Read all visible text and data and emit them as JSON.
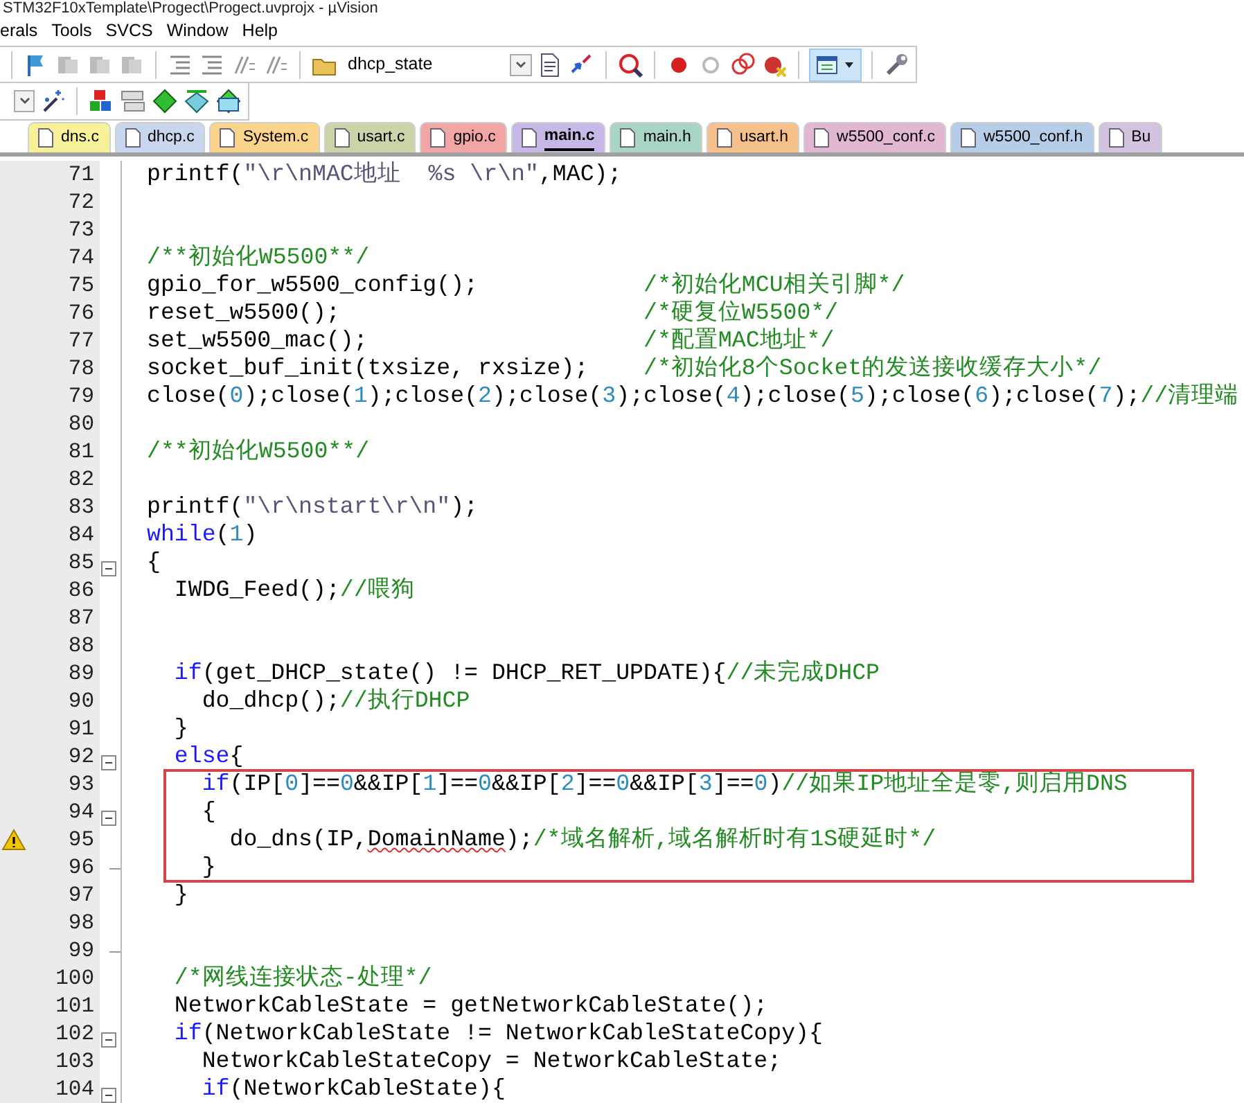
{
  "window": {
    "title": "STM32F10xTemplate\\Progect\\Progect.uvprojx - µVision"
  },
  "menu": [
    "erals",
    "Tools",
    "SVCS",
    "Window",
    "Help"
  ],
  "toolbar": {
    "target_combo": "dhcp_state",
    "window_button_pressed": true
  },
  "tabs": [
    {
      "label": "dns.c",
      "color": "#f7f29a",
      "selected": false
    },
    {
      "label": "dhcp.c",
      "color": "#c9d7ee",
      "selected": false
    },
    {
      "label": "System.c",
      "color": "#f9d48a",
      "selected": false
    },
    {
      "label": "usart.c",
      "color": "#c9d5a8",
      "selected": false
    },
    {
      "label": "gpio.c",
      "color": "#f2a5a5",
      "selected": false
    },
    {
      "label": "main.c",
      "color": "#c8b8e8",
      "selected": true
    },
    {
      "label": "main.h",
      "color": "#a9d5c5",
      "selected": false
    },
    {
      "label": "usart.h",
      "color": "#f6c08a",
      "selected": false
    },
    {
      "label": "w5500_conf.c",
      "color": "#e2b8d0",
      "selected": false
    },
    {
      "label": "w5500_conf.h",
      "color": "#b5cde6",
      "selected": false
    },
    {
      "label": "Bu",
      "color": "#d2c3e0",
      "selected": false
    }
  ],
  "editor": {
    "lines": [
      {
        "number": "71",
        "segments": [
          {
            "kind": "code",
            "text": "printf("
          },
          {
            "kind": "string",
            "text": "\"\\r\\nMAC地址  %s \\r\\n\""
          },
          {
            "kind": "code",
            "text": ",MAC);"
          }
        ]
      },
      {
        "number": "72"
      },
      {
        "number": "73"
      },
      {
        "number": "74",
        "segments": [
          {
            "kind": "comment",
            "text": "/**初始化W5500**/"
          }
        ]
      },
      {
        "number": "75",
        "segments": [
          {
            "kind": "code",
            "text": "gpio_for_w5500_config();            "
          },
          {
            "kind": "comment",
            "text": "/*初始化MCU相关引脚*/"
          }
        ]
      },
      {
        "number": "76",
        "segments": [
          {
            "kind": "code",
            "text": "reset_w5500();                      "
          },
          {
            "kind": "comment",
            "text": "/*硬复位W5500*/"
          }
        ]
      },
      {
        "number": "77",
        "segments": [
          {
            "kind": "code",
            "text": "set_w5500_mac();                    "
          },
          {
            "kind": "comment",
            "text": "/*配置MAC地址*/"
          }
        ]
      },
      {
        "number": "78",
        "segments": [
          {
            "kind": "code",
            "text": "socket_buf_init(txsize, rxsize);    "
          },
          {
            "kind": "comment",
            "text": "/*初始化8个Socket的发送接收缓存大小*/"
          }
        ]
      },
      {
        "number": "79",
        "segments": [
          {
            "kind": "code",
            "text": "close("
          },
          {
            "kind": "number",
            "text": "0"
          },
          {
            "kind": "code",
            "text": ");close("
          },
          {
            "kind": "number",
            "text": "1"
          },
          {
            "kind": "code",
            "text": ");close("
          },
          {
            "kind": "number",
            "text": "2"
          },
          {
            "kind": "code",
            "text": ");close("
          },
          {
            "kind": "number",
            "text": "3"
          },
          {
            "kind": "code",
            "text": ");close("
          },
          {
            "kind": "number",
            "text": "4"
          },
          {
            "kind": "code",
            "text": ");close("
          },
          {
            "kind": "number",
            "text": "5"
          },
          {
            "kind": "code",
            "text": ");close("
          },
          {
            "kind": "number",
            "text": "6"
          },
          {
            "kind": "code",
            "text": ");close("
          },
          {
            "kind": "number",
            "text": "7"
          },
          {
            "kind": "code",
            "text": ");"
          },
          {
            "kind": "comment",
            "text": "//清理端"
          }
        ]
      },
      {
        "number": "80"
      },
      {
        "number": "81",
        "segments": [
          {
            "kind": "comment",
            "text": "/**初始化W5500**/"
          }
        ]
      },
      {
        "number": "82"
      },
      {
        "number": "83",
        "segments": [
          {
            "kind": "code",
            "text": "printf("
          },
          {
            "kind": "string",
            "text": "\"\\r\\nstart\\r\\n\""
          },
          {
            "kind": "code",
            "text": ");"
          }
        ]
      },
      {
        "number": "84",
        "segments": [
          {
            "kind": "keyword",
            "text": "while"
          },
          {
            "kind": "code",
            "text": "("
          },
          {
            "kind": "number",
            "text": "1"
          },
          {
            "kind": "code",
            "text": ")"
          }
        ]
      },
      {
        "number": "85",
        "fold_expanded": true,
        "segments": [
          {
            "kind": "code",
            "text": "{"
          }
        ]
      },
      {
        "number": "86",
        "segments": [
          {
            "kind": "code",
            "text": "  IWDG_Feed();"
          },
          {
            "kind": "comment",
            "text": "//喂狗"
          }
        ]
      },
      {
        "number": "87"
      },
      {
        "number": "88"
      },
      {
        "number": "89",
        "segments": [
          {
            "kind": "keyword",
            "text": "  if"
          },
          {
            "kind": "code",
            "text": "(get_DHCP_state() != DHCP_RET_UPDATE){"
          },
          {
            "kind": "comment",
            "text": "//未完成DHCP"
          }
        ]
      },
      {
        "number": "90",
        "segments": [
          {
            "kind": "code",
            "text": "    do_dhcp();"
          },
          {
            "kind": "comment",
            "text": "//执行DHCP"
          }
        ]
      },
      {
        "number": "91",
        "segments": [
          {
            "kind": "code",
            "text": "  }"
          }
        ]
      },
      {
        "number": "92",
        "fold_expanded": true,
        "segments": [
          {
            "kind": "keyword",
            "text": "  else"
          },
          {
            "kind": "code",
            "text": "{"
          }
        ]
      },
      {
        "number": "93",
        "boxed": true,
        "segments": [
          {
            "kind": "keyword",
            "text": "    if"
          },
          {
            "kind": "code",
            "text": "(IP["
          },
          {
            "kind": "number",
            "text": "0"
          },
          {
            "kind": "code",
            "text": "]=="
          },
          {
            "kind": "number",
            "text": "0"
          },
          {
            "kind": "code",
            "text": "&&IP["
          },
          {
            "kind": "number",
            "text": "1"
          },
          {
            "kind": "code",
            "text": "]=="
          },
          {
            "kind": "number",
            "text": "0"
          },
          {
            "kind": "code",
            "text": "&&IP["
          },
          {
            "kind": "number",
            "text": "2"
          },
          {
            "kind": "code",
            "text": "]=="
          },
          {
            "kind": "number",
            "text": "0"
          },
          {
            "kind": "code",
            "text": "&&IP["
          },
          {
            "kind": "number",
            "text": "3"
          },
          {
            "kind": "code",
            "text": "]=="
          },
          {
            "kind": "number",
            "text": "0"
          },
          {
            "kind": "code",
            "text": ")"
          },
          {
            "kind": "comment",
            "text": "//如果IP地址全是零,则启用DNS"
          }
        ]
      },
      {
        "number": "94",
        "boxed": true,
        "fold_expanded": true,
        "segments": [
          {
            "kind": "code",
            "text": "    {"
          }
        ]
      },
      {
        "number": "95",
        "boxed": true,
        "warning": true,
        "segments": [
          {
            "kind": "code",
            "text": "      do_dns(IP,"
          },
          {
            "kind": "error",
            "text": "DomainName"
          },
          {
            "kind": "code",
            "text": ");"
          },
          {
            "kind": "comment",
            "text": "/*域名解析,域名解析时有1S硬延时*/"
          }
        ]
      },
      {
        "number": "96",
        "boxed": true,
        "fold_end": true,
        "segments": [
          {
            "kind": "code",
            "text": "    }"
          }
        ]
      },
      {
        "number": "97",
        "segments": [
          {
            "kind": "code",
            "text": "  }"
          }
        ]
      },
      {
        "number": "98"
      },
      {
        "number": "99",
        "fold_end": true
      },
      {
        "number": "100",
        "segments": [
          {
            "kind": "comment",
            "text": "  /*网线连接状态-处理*/"
          }
        ]
      },
      {
        "number": "101",
        "segments": [
          {
            "kind": "code",
            "text": "  NetworkCableState = getNetworkCableState();"
          }
        ]
      },
      {
        "number": "102",
        "fold_expanded": true,
        "segments": [
          {
            "kind": "keyword",
            "text": "  if"
          },
          {
            "kind": "code",
            "text": "(NetworkCableState != NetworkCableStateCopy){"
          }
        ]
      },
      {
        "number": "103",
        "segments": [
          {
            "kind": "code",
            "text": "    NetworkCableStateCopy = NetworkCableState;"
          }
        ]
      },
      {
        "number": "104",
        "fold_expanded": true,
        "segments": [
          {
            "kind": "keyword",
            "text": "    if"
          },
          {
            "kind": "code",
            "text": "(NetworkCableState){"
          }
        ]
      }
    ]
  }
}
